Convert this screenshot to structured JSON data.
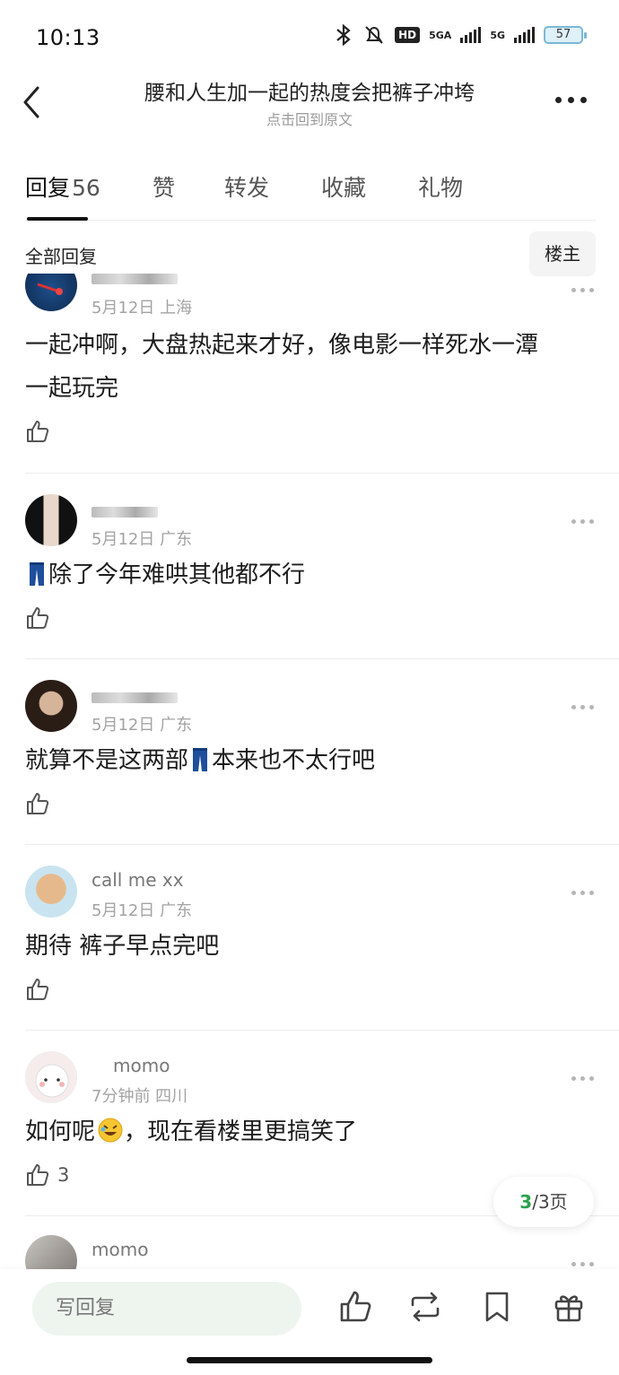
{
  "status_bar": {
    "time": "10:13",
    "network_1": "5GA",
    "network_2": "5G",
    "hd_label": "HD",
    "battery": "57"
  },
  "header": {
    "title": "腰和人生加一起的热度会把裤子冲垮",
    "subtitle": "点击回到原文"
  },
  "tabs": [
    {
      "label": "回复",
      "count": "56"
    },
    {
      "label": "赞"
    },
    {
      "label": "转发"
    },
    {
      "label": "收藏"
    },
    {
      "label": "礼物"
    }
  ],
  "filter": {
    "label": "全部回复",
    "owner_button": "楼主"
  },
  "comments": [
    {
      "meta": "5月12日 上海",
      "text_line1": "一起冲啊，大盘热起来才好，像电影一样死水一潭",
      "text_line2": "一起玩完"
    },
    {
      "meta": "5月12日 广东",
      "text": "除了今年难哄其他都不行"
    },
    {
      "meta": "5月12日 广东",
      "text_before": "就算不是这两部",
      "text_after": "本来也不太行吧"
    },
    {
      "username": "call me xx",
      "meta": "5月12日 广东",
      "text": "期待 裤子早点完吧"
    },
    {
      "username": "momo",
      "meta": "7分钟前 四川",
      "text_before": "如何呢",
      "text_after": "，现在看楼里更搞笑了",
      "likes": "3"
    },
    {
      "username": "momo"
    }
  ],
  "pagination": {
    "current": "3",
    "rest": "/3页"
  },
  "bottom_bar": {
    "reply_placeholder": "写回复"
  },
  "colors": {
    "accent_green": "#2aa24a",
    "input_bg": "#eef5ee"
  }
}
